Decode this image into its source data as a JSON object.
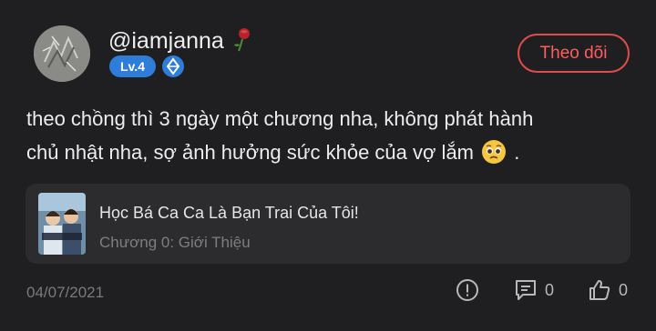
{
  "user": {
    "username": "@iamjanna",
    "level": "Lv.4"
  },
  "follow_label": "Theo dõi",
  "comment": {
    "line1": "theo chồng thì 3 ngày một chương nha, không phát hành",
    "line2": "chủ nhật nha, sợ ảnh hưởng sức khỏe của vợ lắm",
    "line2_end": "."
  },
  "chapter": {
    "story_title": "Học Bá Ca Ca Là Bạn Trai Của Tôi!",
    "chapter_name": "Chương 0: Giới Thiệu"
  },
  "footer": {
    "date": "04/07/2021",
    "reply_count": "0",
    "like_count": "0"
  },
  "icons": {
    "rose": "rose-icon",
    "gem": "gem-icon",
    "emoji": "pleading-face-icon",
    "report": "report-icon",
    "reply": "comment-icon",
    "like": "thumbs-up-icon"
  },
  "colors": {
    "accent_follow": "#e04b4b",
    "level_badge": "#2e7dd8",
    "background": "#1f1f21",
    "card": "#2c2c2f"
  }
}
